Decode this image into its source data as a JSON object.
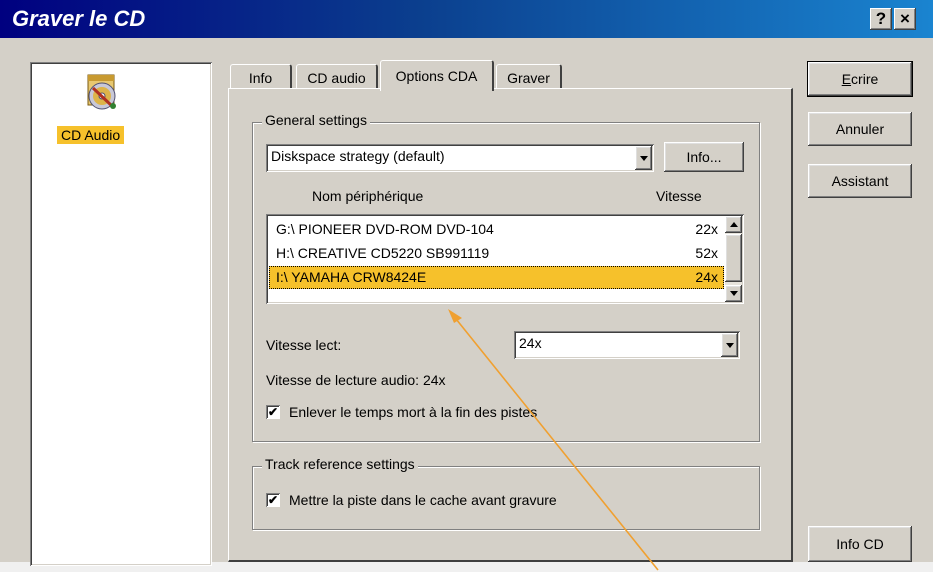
{
  "window": {
    "title": "Graver le CD",
    "help_glyph": "?",
    "close_glyph": "×"
  },
  "left_panel": {
    "items": [
      {
        "label": "CD Audio",
        "icon": "cd-audio-icon"
      }
    ]
  },
  "tabs": [
    {
      "label": "Info"
    },
    {
      "label": "CD audio"
    },
    {
      "label": "Options CDA",
      "active": true
    },
    {
      "label": "Graver"
    }
  ],
  "general": {
    "label": "General settings",
    "strategy": {
      "value": "Diskspace strategy (default)"
    },
    "info_button": "Info...",
    "columns": [
      "Nom périphérique",
      "Vitesse"
    ],
    "drives": [
      {
        "name": "G:\\  PIONEER  DVD-ROM DVD-104",
        "speed": "22x"
      },
      {
        "name": "H:\\  CREATIVE CD5220  SB991119",
        "speed": "52x"
      },
      {
        "name": "I:\\    YAMAHA   CRW8424E",
        "speed": "24x",
        "selected": true
      }
    ],
    "read_speed_label": "Vitesse lect:",
    "read_speed_value": "24x",
    "audio_speed_text": "Vitesse de lecture audio: 24x",
    "remove_gaps": {
      "label": "Enlever le temps mort à la fin des pistes",
      "checked": true,
      "mark": "✔"
    }
  },
  "track": {
    "label": "Track reference settings",
    "cache": {
      "label": "Mettre la piste dans le cache avant gravure",
      "checked": true,
      "mark": "✔"
    }
  },
  "buttons": {
    "write_accel": "E",
    "write_rest": "crire",
    "cancel": "Annuler",
    "wizard": "Assistant",
    "cd_info": "Info CD"
  },
  "colors": {
    "selection": "#f6c12b",
    "arrow": "#f0a030",
    "title_start": "#000080",
    "title_end": "#1a84d0"
  }
}
